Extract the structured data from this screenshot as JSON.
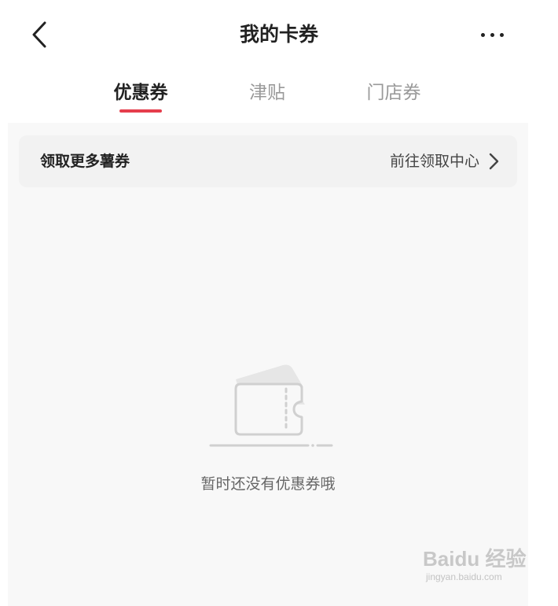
{
  "header": {
    "title": "我的卡券",
    "back_icon": "chevron-left-icon",
    "more_icon": "more-horizontal-icon"
  },
  "tabs": [
    {
      "label": "优惠券",
      "active": true
    },
    {
      "label": "津贴",
      "active": false
    },
    {
      "label": "门店券",
      "active": false
    }
  ],
  "colors": {
    "accent": "#e53e4c",
    "background": "#f8f8f8",
    "promo_bar": "#f2f2f2",
    "empty_illustration": "#d9d9d9"
  },
  "promo": {
    "title": "领取更多薯券",
    "link_text": "前往领取中心",
    "chevron_icon": "chevron-right-icon"
  },
  "empty_state": {
    "icon": "empty-coupon-icon",
    "text": "暂时还没有优惠券哦"
  },
  "watermark": {
    "main": "Baidu 经验",
    "sub": "jingyan.baidu.com"
  }
}
